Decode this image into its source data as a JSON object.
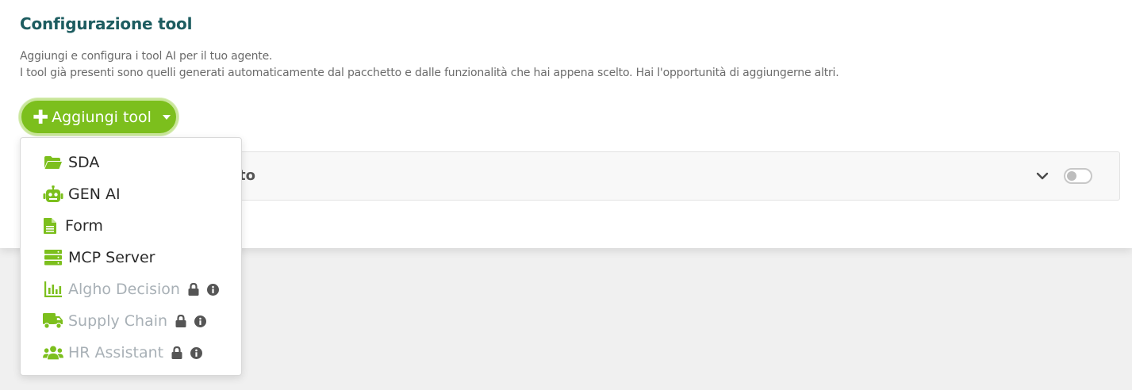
{
  "header": {
    "title": "Configurazione tool",
    "description_line1": "Aggiungi e configura i tool AI per il tuo agente.",
    "description_line2": "I tool già presenti sono quelli generati automaticamente dal pacchetto e dalle funzionalità che hai appena scelto. Hai l'opportunità di aggiungerne altri."
  },
  "add_button": {
    "icon": "plus-icon",
    "label": "Aggiungi tool",
    "caret_icon": "caret-down-icon"
  },
  "tool_panel": {
    "title_fragment": "to",
    "chevron_icon": "chevron-down-icon",
    "toggle_on": false
  },
  "dropdown": {
    "items": [
      {
        "label": "SDA",
        "icon": "folder-open-icon",
        "disabled": false
      },
      {
        "label": "GEN AI",
        "icon": "robot-icon",
        "disabled": false
      },
      {
        "label": "Form",
        "icon": "file-text-icon",
        "disabled": false
      },
      {
        "label": "MCP Server",
        "icon": "server-icon",
        "disabled": false
      },
      {
        "label": "Algho Decision",
        "icon": "bar-chart-icon",
        "disabled": true
      },
      {
        "label": "Supply Chain",
        "icon": "truck-icon",
        "disabled": true
      },
      {
        "label": "HR Assistant",
        "icon": "users-icon",
        "disabled": true
      }
    ]
  },
  "colors": {
    "accent": "#7cbf1d",
    "title": "#1d5c60",
    "disabled_text": "#a8b0b6"
  }
}
